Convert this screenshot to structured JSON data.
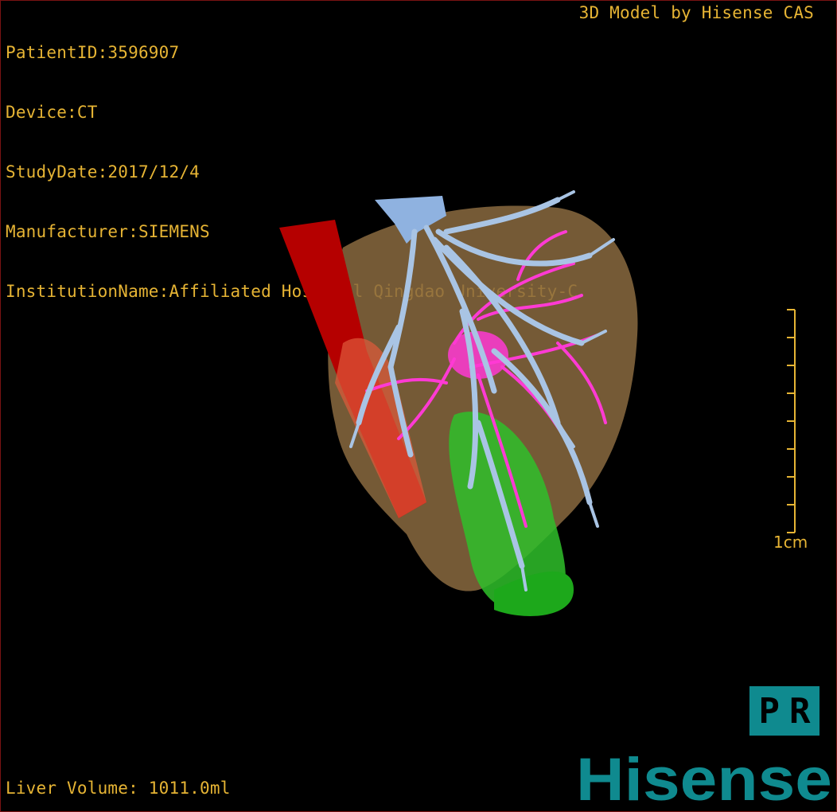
{
  "info": {
    "patient_id": "PatientID:3596907",
    "device": "Device:CT",
    "study_date": "StudyDate:2017/12/4",
    "manufacturer": "Manufacturer:SIEMENS",
    "institution": "InstitutionName:Affiliated Hospital Qingdao University-C"
  },
  "credit": "3D Model by Hisense CAS",
  "volume": "Liver Volume: 1011.0ml",
  "scale_label": "1cm",
  "orientation": {
    "left": "P",
    "right": "R"
  },
  "brand": "Hisense",
  "colors": {
    "overlay_text": "#e6b434",
    "liver": "#8a6a40",
    "vena_cava": "#b50000",
    "portal_vein": "#a9c4e4",
    "hepatic_vessels": "#ff3ad4",
    "gallbladder": "#2fbf2a",
    "brand": "#0f8a8f"
  }
}
